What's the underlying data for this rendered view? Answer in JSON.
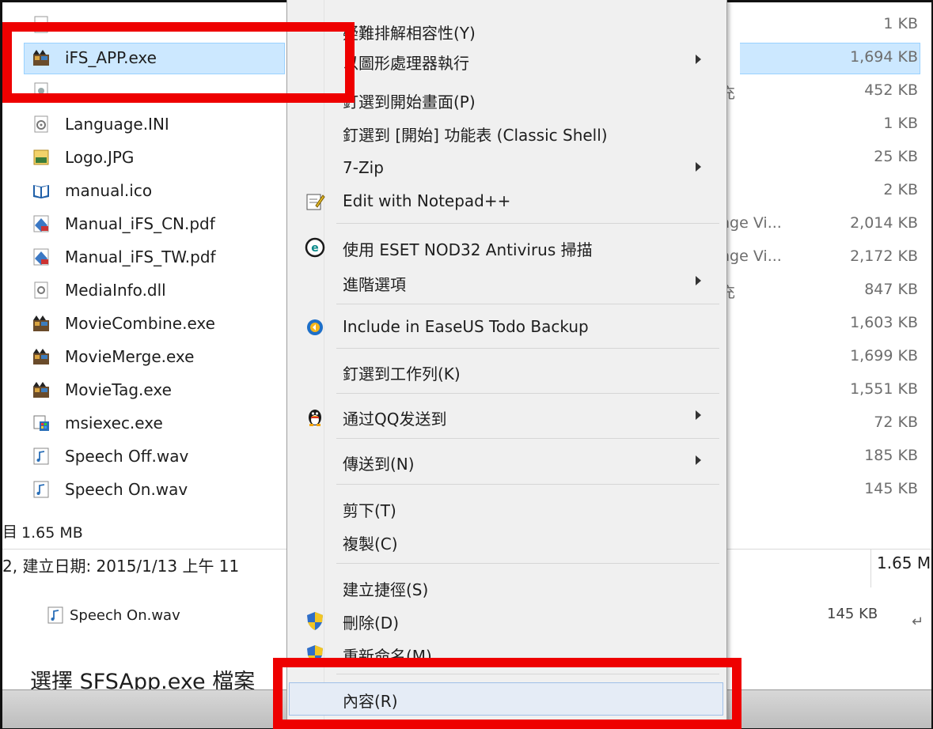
{
  "files": [
    {
      "name": "",
      "size": "1 KB",
      "icon": "file-icon",
      "extra": ""
    },
    {
      "name": "iFS_APP.exe",
      "size": "1,694 KB",
      "icon": "app-exe-icon",
      "extra": "",
      "selected": true
    },
    {
      "name": "",
      "size": "452 KB",
      "icon": "dll-icon",
      "extra": "充"
    },
    {
      "name": "Language.INI",
      "size": "1 KB",
      "icon": "ini-settings-icon",
      "extra": ""
    },
    {
      "name": "Logo.JPG",
      "size": "25 KB",
      "icon": "jpg-image-icon",
      "extra": ""
    },
    {
      "name": "manual.ico",
      "size": "2 KB",
      "icon": "book-icon",
      "extra": ""
    },
    {
      "name": "Manual_iFS_CN.pdf",
      "size": "2,014 KB",
      "icon": "pdf-icon",
      "extra": "nge Vi..."
    },
    {
      "name": "Manual_iFS_TW.pdf",
      "size": "2,172 KB",
      "icon": "pdf-icon",
      "extra": "nge Vi..."
    },
    {
      "name": "MediaInfo.dll",
      "size": "847 KB",
      "icon": "dll-icon",
      "extra": "充"
    },
    {
      "name": "MovieCombine.exe",
      "size": "1,603 KB",
      "icon": "app-exe-icon",
      "extra": ""
    },
    {
      "name": "MovieMerge.exe",
      "size": "1,699 KB",
      "icon": "app-exe-icon",
      "extra": ""
    },
    {
      "name": "MovieTag.exe",
      "size": "1,551 KB",
      "icon": "app-exe-icon",
      "extra": ""
    },
    {
      "name": "msiexec.exe",
      "size": "72 KB",
      "icon": "installer-icon",
      "extra": ""
    },
    {
      "name": "Speech Off.wav",
      "size": "185 KB",
      "icon": "audio-file-icon",
      "extra": ""
    },
    {
      "name": "Speech On.wav",
      "size": "145 KB",
      "icon": "audio-file-icon",
      "extra": ""
    }
  ],
  "status": {
    "items_prefix": "目",
    "selected_size": "1.65 MB",
    "details": "2, 建立日期: 2015/1/13 上午 11",
    "size_right": "1.65 M"
  },
  "document": {
    "file_name": "Speech On.wav",
    "file_size": "145 KB",
    "return_mark": "↵",
    "instruction": "選擇 SFSApp.exe 檔案"
  },
  "context_menu": {
    "items": [
      {
        "label": "疑難排解相容性(Y)",
        "icon": "",
        "arrow": false
      },
      {
        "label": "以圖形處理器執行",
        "icon": "",
        "arrow": true
      },
      {
        "label": "釘選到開始畫面(P)",
        "icon": "",
        "arrow": false
      },
      {
        "label": "釘選到 [開始] 功能表 (Classic Shell)",
        "icon": "",
        "arrow": false
      },
      {
        "label": "7-Zip",
        "icon": "",
        "arrow": true
      },
      {
        "label": "Edit with Notepad++",
        "icon": "notepad-plus-icon",
        "arrow": false
      },
      {
        "label": "使用 ESET NOD32 Antivirus 掃描",
        "icon": "eset-icon",
        "arrow": false
      },
      {
        "label": "進階選項",
        "icon": "",
        "arrow": true
      },
      {
        "label": "Include in EaseUS Todo Backup",
        "icon": "easeus-icon",
        "arrow": false
      },
      {
        "label": "釘選到工作列(K)",
        "icon": "",
        "arrow": false
      },
      {
        "label": "通过QQ发送到",
        "icon": "qq-penguin-icon",
        "arrow": true
      },
      {
        "label": "傳送到(N)",
        "icon": "",
        "arrow": true
      },
      {
        "label": "剪下(T)",
        "icon": "",
        "arrow": false
      },
      {
        "label": "複製(C)",
        "icon": "",
        "arrow": false
      },
      {
        "label": "建立捷徑(S)",
        "icon": "",
        "arrow": false
      },
      {
        "label": "刪除(D)",
        "icon": "uac-shield-icon",
        "arrow": false
      },
      {
        "label": "重新命名(M)",
        "icon": "uac-shield-icon",
        "arrow": false
      },
      {
        "label": "內容(R)",
        "icon": "",
        "arrow": false
      }
    ]
  },
  "colors": {
    "highlight_red": "#ee0000",
    "selection_blue": "#cce8ff"
  }
}
